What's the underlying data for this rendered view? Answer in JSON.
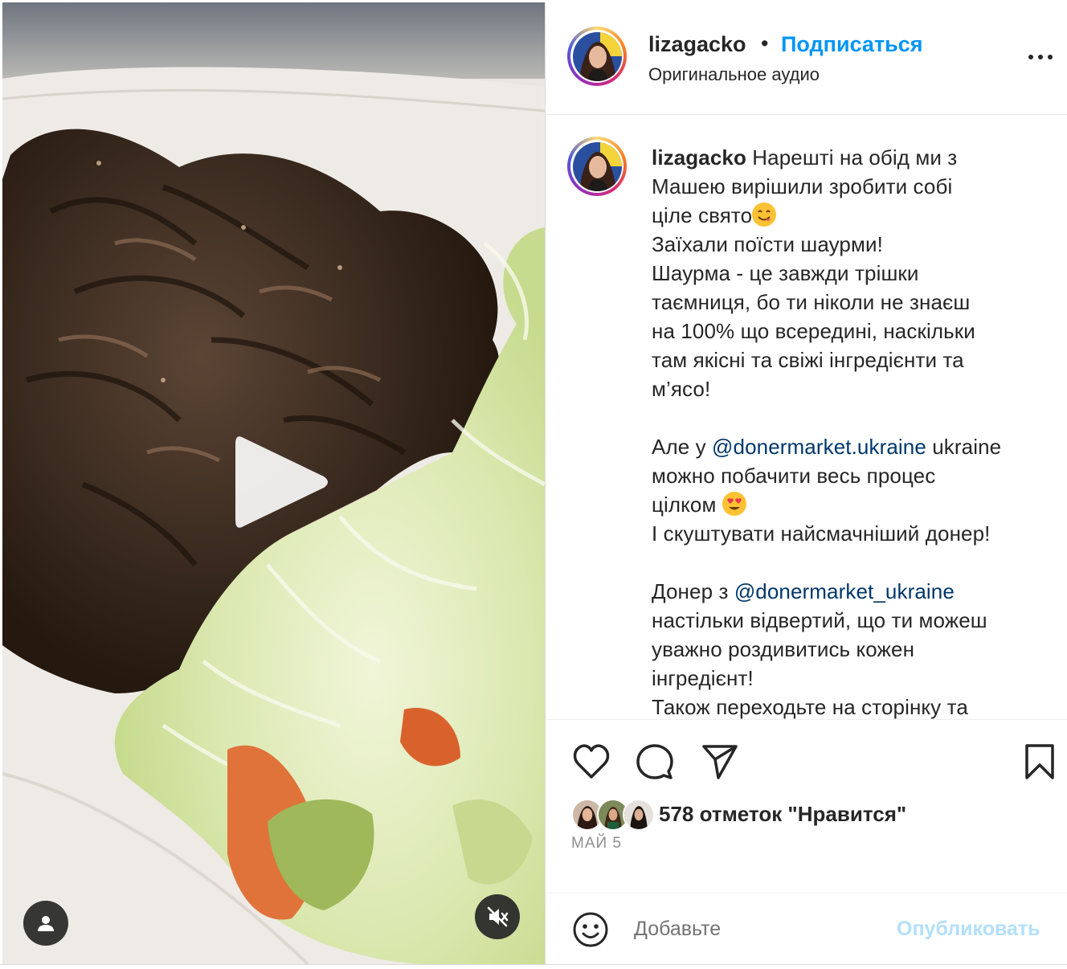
{
  "post": {
    "username": "lizagacko",
    "follow_label": "Подписаться",
    "separator": "•",
    "audio_label": "Оригинальное аудио"
  },
  "caption": {
    "username": "lizagacko",
    "lines": [
      " Нарешті на обід ми з",
      "Машею вирішили зробити собі",
      "ціле свято",
      "Заїхали поїсти шаурми!",
      "Шаурма - це завжди трішки",
      "таємниця, бо ти ніколи не знаєш",
      "на 100% що всередині, наскільки",
      "там якісні та свіжі інгредієнти та",
      "м’ясо!",
      "Але у ",
      "@donermarket.ukraine",
      " ukraine",
      "можно побачити весь процес",
      "цілком ",
      "І скуштувати найсмачніший донер!",
      "Донер з ",
      "@donermarket_ukraine",
      "настільки відвертий, що ти можеш",
      "уважно роздивитись кожен",
      "інгредієнт!",
      "Також переходьте на сторінку та"
    ],
    "emojis": [
      "yum-emoji",
      "heart-eyes-emoji"
    ]
  },
  "engagement": {
    "likes_text": "578 отметок \"Нравится\"",
    "date": "МАЙ 5"
  },
  "comment_box": {
    "placeholder": "Добавьте",
    "publish_label": "Опубликовать"
  },
  "icons": {
    "like": "heart-icon",
    "comment": "comment-bubble-icon",
    "share": "paper-plane-icon",
    "save": "bookmark-icon",
    "more": "more-dots-icon",
    "play": "play-icon",
    "user_tag": "user-tag-icon",
    "mute": "speaker-muted-icon",
    "emoji": "smiley-icon"
  },
  "colors": {
    "follow_blue": "#0095f6",
    "mention": "#00376b",
    "publish_disabled": "#b2dffc",
    "text": "#262626",
    "muted": "#8e8e8e"
  }
}
